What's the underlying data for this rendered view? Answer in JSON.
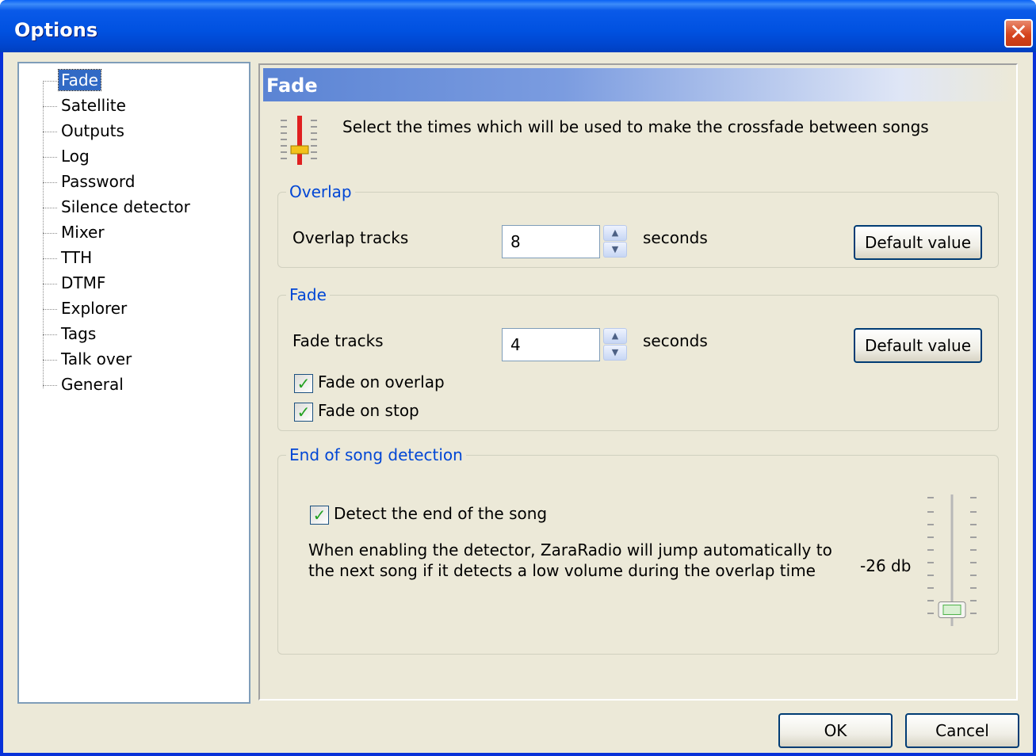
{
  "window": {
    "title": "Options",
    "close_glyph": "✕"
  },
  "tree": {
    "items": [
      {
        "label": "Fade",
        "selected": true
      },
      {
        "label": "Satellite"
      },
      {
        "label": "Outputs"
      },
      {
        "label": "Log"
      },
      {
        "label": "Password"
      },
      {
        "label": "Silence detector"
      },
      {
        "label": "Mixer"
      },
      {
        "label": "TTH"
      },
      {
        "label": "DTMF"
      },
      {
        "label": "Explorer"
      },
      {
        "label": "Tags"
      },
      {
        "label": "Talk over"
      },
      {
        "label": "General"
      }
    ]
  },
  "panel": {
    "title": "Fade",
    "icon": "fader-icon",
    "intro": "Select the times which will be used to make the crossfade between songs"
  },
  "overlap": {
    "legend": "Overlap",
    "label": "Overlap tracks",
    "value": "8",
    "unit": "seconds",
    "default_button": "Default value"
  },
  "fade": {
    "legend": "Fade",
    "label": "Fade tracks",
    "value": "4",
    "unit": "seconds",
    "default_button": "Default value",
    "fade_on_overlap": {
      "label": "Fade on overlap",
      "checked": true
    },
    "fade_on_stop": {
      "label": "Fade on stop",
      "checked": true
    }
  },
  "end_detection": {
    "legend": "End of song detection",
    "detect": {
      "label": "Detect the end of the song",
      "checked": true
    },
    "description_line1": "When enabling the detector, ZaraRadio will jump automatically to",
    "description_line2": "the next song if it detects a low volume during the overlap time",
    "level_label": "-26 db",
    "slider_level": 0.06
  },
  "footer": {
    "ok": "OK",
    "cancel": "Cancel"
  },
  "colors": {
    "title_bar": "#0054e3",
    "legend": "#0046d5",
    "selection": "#316ac5",
    "check": "#21a121"
  }
}
